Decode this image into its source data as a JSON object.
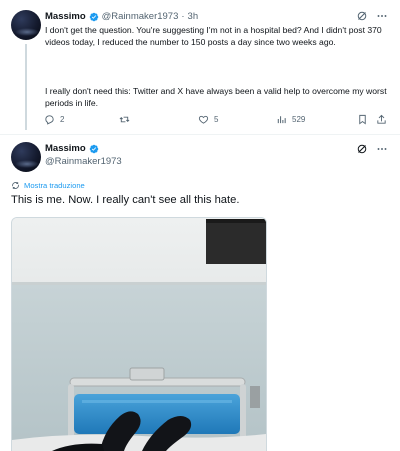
{
  "tweet1": {
    "name": "Massimo",
    "handle": "@Rainmaker1973",
    "separator": "·",
    "time": "3h",
    "paragraph1": "I don't get the question. You're suggesting I'm not in a hospital bed? And I didn't post 370 videos today, I reduced the number to 150 posts a day since two weeks ago.",
    "paragraph2": "I really don't need this: Twitter and X have always been a valid help to overcome my worst periods in life.",
    "actions": {
      "replies": "2",
      "likes": "5",
      "views": "529"
    }
  },
  "tweet2": {
    "name": "Massimo",
    "handle": "@Rainmaker1973",
    "translate_label": "Mostra traduzione",
    "text": "This is me. Now. I really can't see all this hate."
  },
  "colors": {
    "accent": "#1d9bf0",
    "text": "#0f1419",
    "muted": "#536471",
    "divider": "#eff3f4"
  },
  "icons": [
    "verified-badge-icon",
    "grok-icon",
    "more-icon",
    "reply-icon",
    "retweet-icon",
    "like-icon",
    "views-icon",
    "bookmark-icon",
    "share-icon",
    "translate-icon"
  ]
}
